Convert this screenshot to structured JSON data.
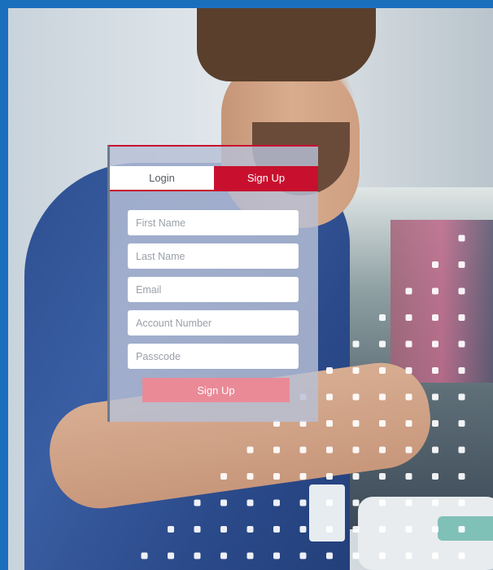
{
  "tabs": {
    "login": "Login",
    "signup": "Sign Up"
  },
  "form": {
    "first_name_placeholder": "First Name",
    "last_name_placeholder": "Last Name",
    "email_placeholder": "Email",
    "account_number_placeholder": "Account Number",
    "passcode_placeholder": "Passcode",
    "submit_label": "Sign Up"
  },
  "colors": {
    "brand_red": "#c8102e",
    "submit_pink": "#ea8a97",
    "frame_blue": "#1a6fbd"
  }
}
